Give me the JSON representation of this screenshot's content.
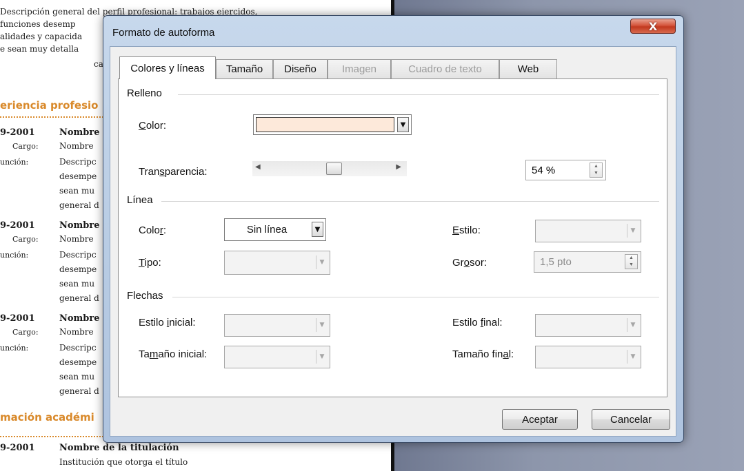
{
  "document": {
    "lines": [
      "Descripción  general del perfil profesional: trabajos ejercidos,",
      " funciones desemp",
      "alidades y capacida",
      "e sean muy detalla",
      "ca"
    ],
    "heading_experience": "eriencia profesio",
    "heading_education": "mación académi",
    "entries": [
      {
        "year": "9-2001",
        "name": "Nombre",
        "cargo_label": "Cargo:",
        "cargo": "Nombre",
        "funcion_label": "unción:",
        "lines": [
          "Descripc",
          "desempe",
          "sean mu",
          "general d"
        ]
      },
      {
        "year": "9-2001",
        "name": "Nombre",
        "cargo_label": "Cargo:",
        "cargo": "Nombre",
        "funcion_label": "unción:",
        "lines": [
          "Descripc",
          "desempe",
          "sean mu",
          "general d"
        ]
      },
      {
        "year": "9-2001",
        "name": "Nombre",
        "cargo_label": "Cargo:",
        "cargo": "Nombre",
        "funcion_label": "unción:",
        "lines": [
          "Descripc",
          "desempe",
          "sean mu",
          "general d"
        ]
      }
    ],
    "education_year": "9-2001",
    "education_name": "Nombre de la titulación",
    "education_institution": "Institución que otorga el título"
  },
  "dialog": {
    "title": "Formato de autoforma",
    "close_glyph": "X",
    "tabs": [
      {
        "label": "Colores y líneas",
        "active": true,
        "disabled": false
      },
      {
        "label": "Tamaño",
        "active": false,
        "disabled": false
      },
      {
        "label": "Diseño",
        "active": false,
        "disabled": false
      },
      {
        "label": "Imagen",
        "active": false,
        "disabled": true
      },
      {
        "label": "Cuadro de texto",
        "active": false,
        "disabled": true
      },
      {
        "label": "Web",
        "active": false,
        "disabled": false
      }
    ],
    "fill": {
      "section": "Relleno",
      "color_label_pre": "",
      "color_label_u": "C",
      "color_label_post": "olor:",
      "color_value": "#fde9da",
      "transparency_label_pre": "Tran",
      "transparency_label_u": "s",
      "transparency_label_post": "parencia:",
      "transparency_value": "54 %",
      "transparency_percent": 54
    },
    "line": {
      "section": "Línea",
      "color_label_pre": "Colo",
      "color_label_u": "r",
      "color_label_post": ":",
      "color_value": "Sin línea",
      "type_label_pre": "",
      "type_label_u": "T",
      "type_label_post": "ipo:",
      "style_label_pre": "",
      "style_label_u": "E",
      "style_label_post": "stilo:",
      "weight_label_pre": "Gr",
      "weight_label_u": "o",
      "weight_label_post": "sor:",
      "weight_value": "1,5 pto"
    },
    "arrows": {
      "section": "Flechas",
      "start_style_label_pre": "Estilo ",
      "start_style_label_u": "i",
      "start_style_label_post": "nicial:",
      "start_size_label_pre": "Ta",
      "start_size_label_u": "m",
      "start_size_label_post": "año inicial:",
      "end_style_label_pre": "Estilo ",
      "end_style_label_u": "f",
      "end_style_label_post": "inal:",
      "end_size_label_pre": "Tamaño fin",
      "end_size_label_u": "a",
      "end_size_label_post": "l:"
    },
    "ok_label": "Aceptar",
    "cancel_label": "Cancelar"
  }
}
